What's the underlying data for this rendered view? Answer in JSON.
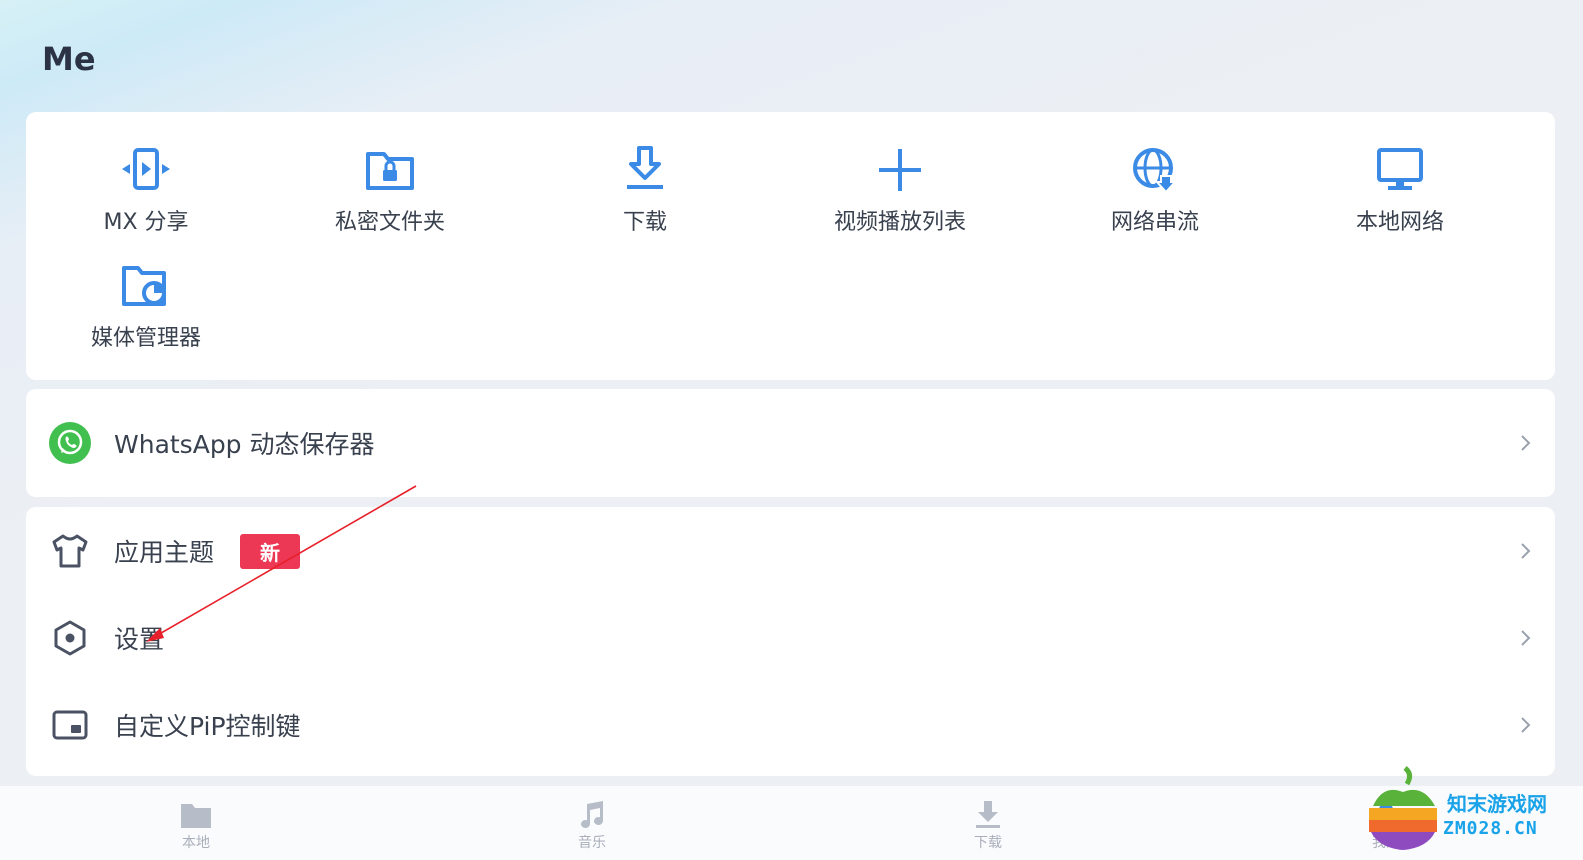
{
  "header": {
    "title": "Me"
  },
  "quick_actions": [
    {
      "label": "MX 分享",
      "icon": "mx-share-icon"
    },
    {
      "label": "私密文件夹",
      "icon": "private-folder-icon"
    },
    {
      "label": "下载",
      "icon": "download-icon"
    },
    {
      "label": "视频播放列表",
      "icon": "plus-icon"
    },
    {
      "label": "网络串流",
      "icon": "network-stream-icon"
    },
    {
      "label": "本地网络",
      "icon": "monitor-icon"
    },
    {
      "label": "媒体管理器",
      "icon": "media-manager-icon"
    }
  ],
  "whatsapp": {
    "label": "WhatsApp 动态保存器",
    "icon": "whatsapp-icon"
  },
  "menu": [
    {
      "label": "应用主题",
      "icon": "tshirt-icon",
      "badge": "新"
    },
    {
      "label": "设置",
      "icon": "settings-icon"
    },
    {
      "label": "自定义PiP控制键",
      "icon": "pip-icon"
    }
  ],
  "bottom_nav": [
    {
      "label": "本地",
      "icon": "folder-icon"
    },
    {
      "label": "音乐",
      "icon": "music-icon"
    },
    {
      "label": "下载",
      "icon": "download-icon"
    },
    {
      "label": "我的",
      "icon": "me-icon"
    }
  ],
  "watermark": {
    "line1": "知末游戏网",
    "line2": "ZM028.CN"
  },
  "colors": {
    "accent": "#3a8ae6",
    "badge": "#ec3755",
    "whatsapp": "#41c04f",
    "annotation": "#e8202a"
  }
}
